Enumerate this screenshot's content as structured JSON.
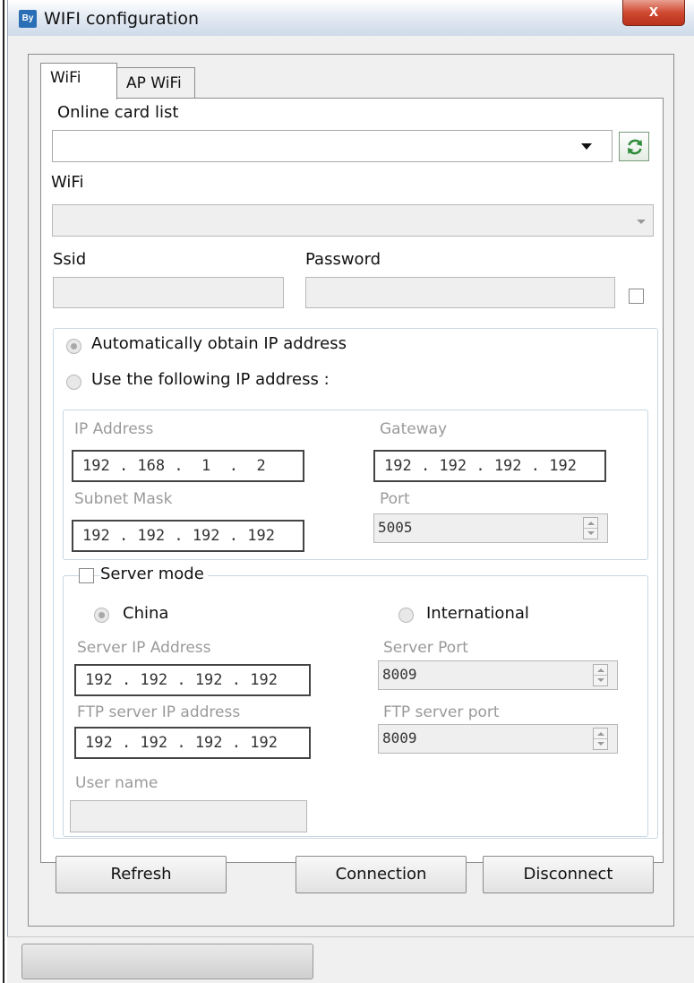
{
  "window": {
    "title": "WIFI configuration",
    "app_icon_text": "By",
    "close_glyph": "x"
  },
  "tabs": [
    {
      "label": "WiFi",
      "selected": true
    },
    {
      "label": "AP WiFi",
      "selected": false
    }
  ],
  "wifi": {
    "online_card_label": "Online card list",
    "online_card_value": "",
    "wifi_label": "WiFi",
    "wifi_value": "",
    "ssid_label": "Ssid",
    "ssid_value": "",
    "password_label": "Password",
    "password_value": "",
    "show_password_checked": false
  },
  "ip": {
    "auto_label": "Automatically obtain IP address",
    "manual_label": "Use the following IP address :",
    "auto_selected": true,
    "ip_address_label": "IP Address",
    "ip_address_value": "192 . 168 .  1  .  2",
    "gateway_label": "Gateway",
    "gateway_value": "192 . 192 . 192 . 192",
    "subnet_label": "Subnet Mask",
    "subnet_value": "192 . 192 . 192 . 192",
    "port_label": "Port",
    "port_value": "5005"
  },
  "server": {
    "mode_label": "Server mode",
    "mode_checked": false,
    "china_label": "China",
    "international_label": "International",
    "china_selected": true,
    "server_ip_label": "Server IP Address",
    "server_ip_value": "192 . 192 . 192 . 192",
    "server_port_label": "Server Port",
    "server_port_value": "8009",
    "ftp_ip_label": "FTP server IP address",
    "ftp_ip_value": "192 . 192 . 192 . 192",
    "ftp_port_label": "FTP server port",
    "ftp_port_value": "8009",
    "username_label": "User name",
    "username_value": ""
  },
  "buttons": {
    "refresh": "Refresh",
    "connection": "Connection",
    "disconnect": "Disconnect"
  },
  "icons": {
    "refresh": "refresh-icon",
    "dropdown": "chevron-down-icon",
    "spin": "spinner-arrows-icon"
  },
  "colors": {
    "accent_green": "#2e8b3a",
    "disabled_text": "#9a9a9a",
    "group_border": "#c8d8e4"
  }
}
